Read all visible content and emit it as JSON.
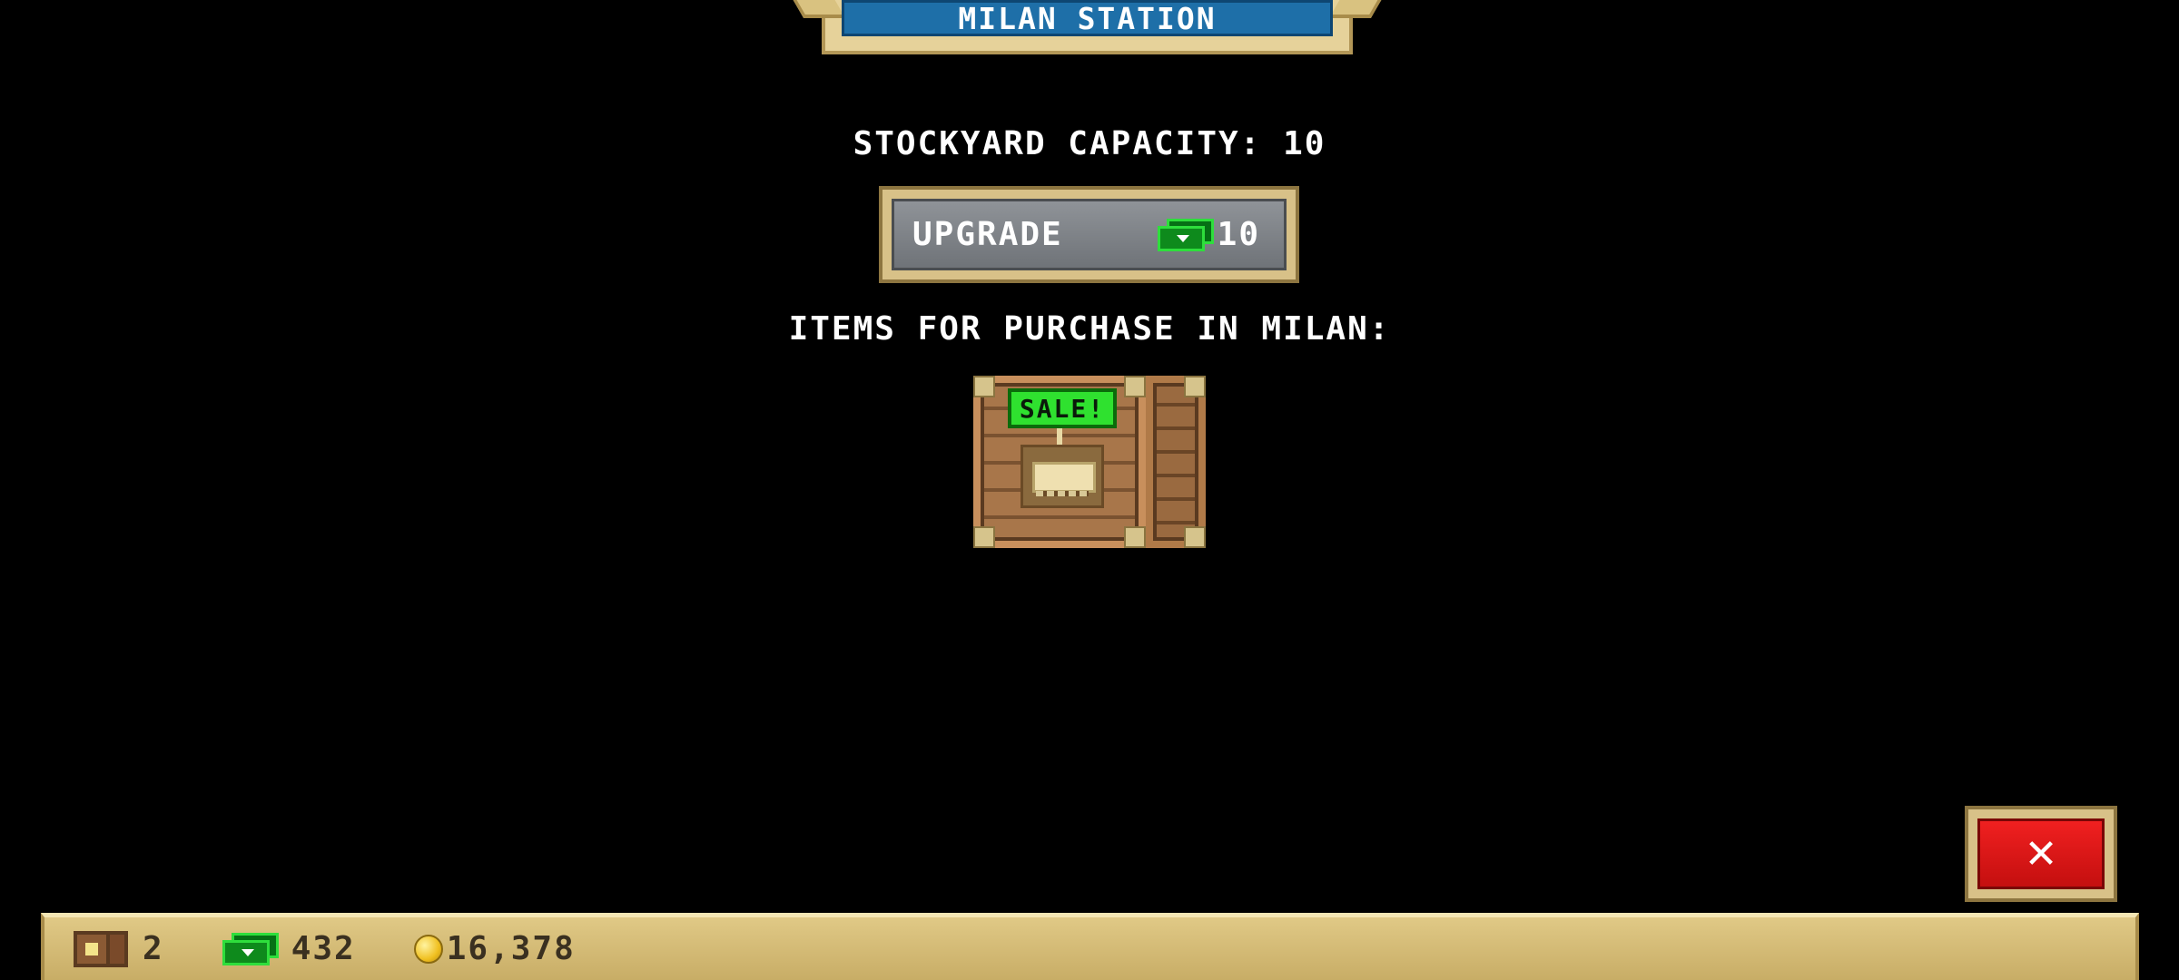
{
  "header": {
    "title": "MILAN STATION"
  },
  "stockyard": {
    "label": "STOCKYARD CAPACITY:",
    "value": "10"
  },
  "upgrade": {
    "label": "UPGRADE",
    "cost": "10",
    "cost_icon": "cash-icon"
  },
  "items": {
    "heading": "ITEMS FOR PURCHASE IN MILAN:",
    "list": [
      {
        "tag": "SALE!",
        "icon": "crate-icon"
      }
    ]
  },
  "close": {
    "label": "✕"
  },
  "resources": {
    "crates": {
      "icon": "crate-icon",
      "value": "2"
    },
    "cash": {
      "icon": "cash-icon",
      "value": "432"
    },
    "coins": {
      "icon": "coin-icon",
      "value": "16,378"
    }
  },
  "colors": {
    "title_bg": "#1e6fa8",
    "frame": "#d8c188",
    "sale_tag": "#2fe12f",
    "close_btn": "#e01515",
    "cash": "#0e8a1c"
  }
}
